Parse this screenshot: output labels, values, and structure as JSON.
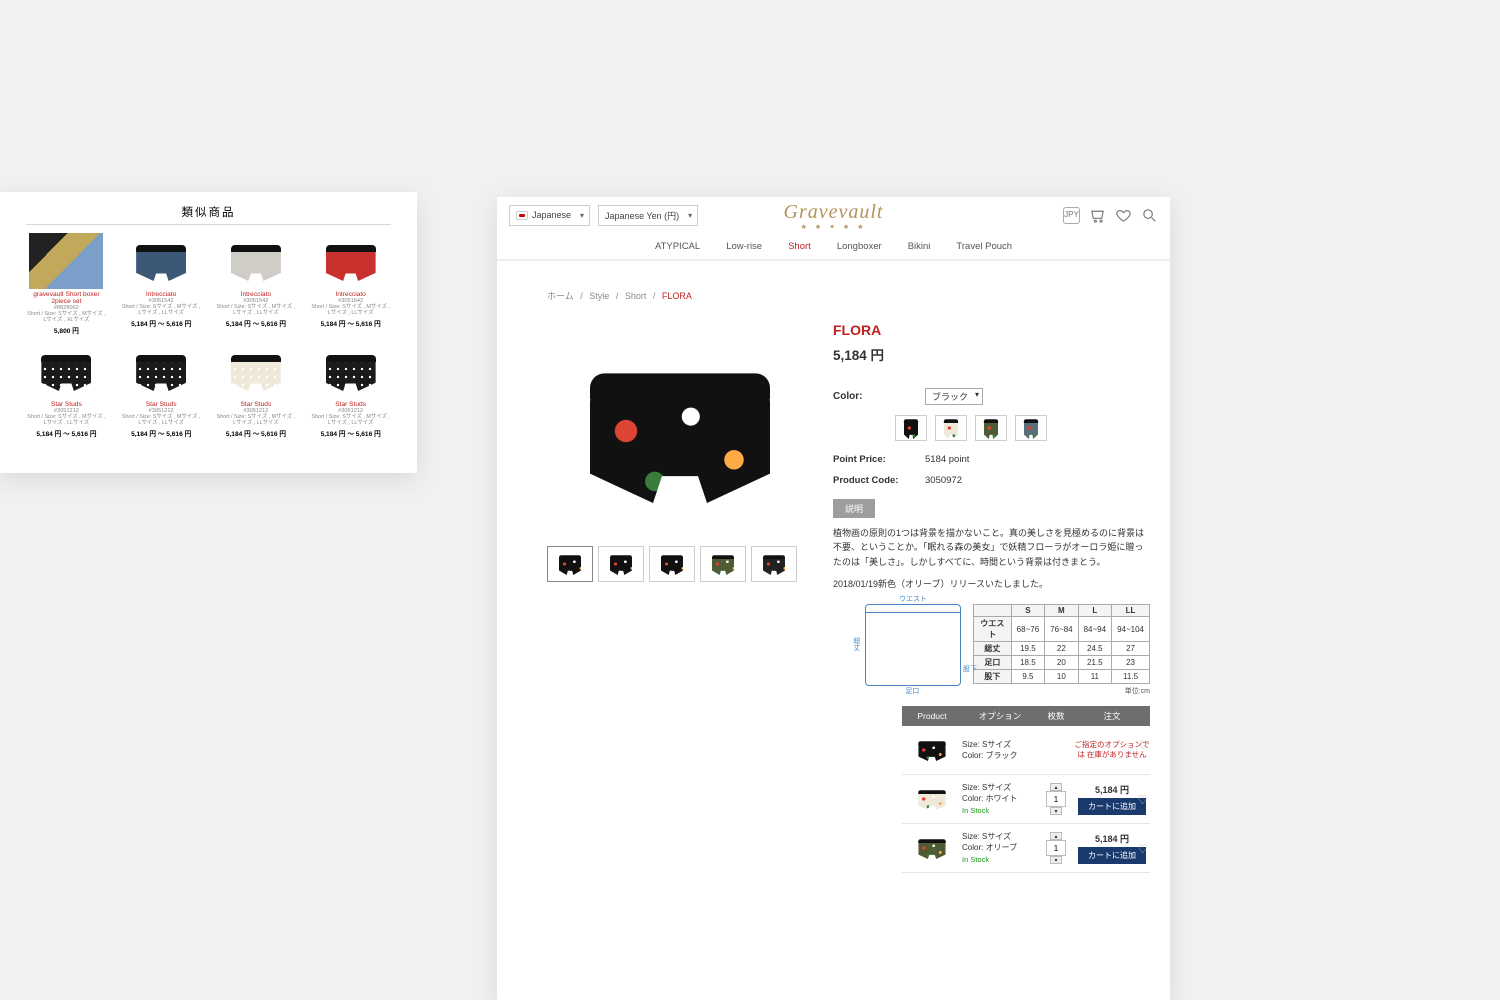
{
  "related": {
    "title": "類似商品",
    "cards": [
      {
        "name": "gravevault Short boxer 2piece set",
        "code": "#8828062",
        "sizes": "Short / Size: Sサイズ , Mサイズ , Lサイズ , XLサイズ",
        "price": "5,800 円",
        "color": "set"
      },
      {
        "name": "Intrecciato",
        "code": "#3051542",
        "sizes": "Short / Size: Sサイズ , Mサイズ , Lサイズ , LLサイズ",
        "price": "5,184 円 ～ 5,616 円",
        "color": "#3b5876"
      },
      {
        "name": "Intrecciato",
        "code": "#3051542",
        "sizes": "Short / Size: Sサイズ , Mサイズ , Lサイズ , LLサイズ",
        "price": "5,184 円 ～ 5,616 円",
        "color": "#d0cdc6"
      },
      {
        "name": "Intrecciato",
        "code": "#3051542",
        "sizes": "Short / Size: Sサイズ , Mサイズ , Lサイズ , LLサイズ",
        "price": "5,184 円 ～ 5,616 円",
        "color": "#c9312f"
      },
      {
        "name": "Star Studs",
        "code": "#3051212",
        "sizes": "Short / Size: Sサイズ , Mサイズ , Lサイズ , LLサイズ",
        "price": "5,184 円 ～ 5,616 円",
        "color": "#1b1b1b",
        "pattern": "dot"
      },
      {
        "name": "Star Studs",
        "code": "#3051212",
        "sizes": "Short / Size: Sサイズ , Mサイズ , Lサイズ , LLサイズ",
        "price": "5,184 円 ～ 5,616 円",
        "color": "#1b1b1b",
        "pattern": "dot"
      },
      {
        "name": "Star Studs",
        "code": "#3051212",
        "sizes": "Short / Size: Sサイズ , Mサイズ , Lサイズ , LLサイズ",
        "price": "5,184 円 ～ 5,616 円",
        "color": "#efe9d9",
        "pattern": "dot"
      },
      {
        "name": "Star Studs",
        "code": "#3051212",
        "sizes": "Short / Size: Sサイズ , Mサイズ , Lサイズ , LLサイズ",
        "price": "5,184 円 ～ 5,616 円",
        "color": "#1b1b1b",
        "pattern": "dot"
      }
    ]
  },
  "header": {
    "lang": "Japanese",
    "currency": "Japanese Yen (円)",
    "brand": "Gravevault",
    "brand_sub": "★ ★ ✦ ★ ★"
  },
  "nav": {
    "items": [
      "ATYPICAL",
      "Low-rise",
      "Short",
      "Longboxer",
      "Bikini",
      "Travel Pouch"
    ],
    "active": 2
  },
  "breadcrumb": {
    "items": [
      "ホーム",
      "Style",
      "Short"
    ],
    "current": "FLORA",
    "sep": "/"
  },
  "product": {
    "title": "FLORA",
    "price": "5,184 円",
    "color_label": "Color:",
    "color_value": "ブラック",
    "point_label": "Point Price:",
    "point_value": "5184 point",
    "code_label": "Product Code:",
    "code_value": "3050972",
    "desc_tab": "説明",
    "desc": "植物画の原則の1つは背景を描かないこと。真の美しさを見極めるのに背景は不要、ということか。「眠れる森の美女」で妖精フローラがオーロラ姫に贈ったのは「美しさ」。しかしすべてに、時間という背景は付きまとう。",
    "note": "2018/01/19新色（オリーブ）リリースいたしました。",
    "swatches": [
      {
        "c": "#111",
        "p": "flower"
      },
      {
        "c": "#efe9da",
        "p": "flower"
      },
      {
        "c": "#4e5c34",
        "p": "flower"
      },
      {
        "c": "#5b6e7b",
        "p": "flower"
      }
    ],
    "thumbs": [
      {
        "c": "#111"
      },
      {
        "c": "#111"
      },
      {
        "c": "#111"
      },
      {
        "c": "#4e5c34"
      },
      {
        "c": "#222"
      }
    ]
  },
  "sizes": {
    "diagram": {
      "top": "ウエスト",
      "side": "総丈",
      "leg": "股下",
      "bot": "足口"
    },
    "unit": "単位:cm",
    "headers": [
      "",
      "S",
      "M",
      "L",
      "LL"
    ],
    "rows": [
      [
        "ウエスト",
        "68~76",
        "76~84",
        "84~94",
        "94~104"
      ],
      [
        "総丈",
        "19.5",
        "22",
        "24.5",
        "27"
      ],
      [
        "足口",
        "18.5",
        "20",
        "21.5",
        "23"
      ],
      [
        "股下",
        "9.5",
        "10",
        "11",
        "11.5"
      ]
    ]
  },
  "variants": {
    "headers": {
      "product": "Product",
      "option": "オプション",
      "qty": "枚数",
      "order": "注文"
    },
    "rows": [
      {
        "size": "Size: Sサイズ",
        "color": "Color: ブラック",
        "stock": "",
        "swatch": "#111",
        "status": "oos",
        "oos": "ご指定のオプションでは\n在庫がありません"
      },
      {
        "size": "Size: Sサイズ",
        "color": "Color: ホワイト",
        "stock": "In Stock",
        "swatch": "#efe9da",
        "status": "ok",
        "qty": "1",
        "price": "5,184 円",
        "btn": "カートに追加"
      },
      {
        "size": "Size: Sサイズ",
        "color": "Color: オリーブ",
        "stock": "In Stock",
        "swatch": "#4e5c34",
        "status": "ok",
        "qty": "1",
        "price": "5,184 円",
        "btn": "カートに追加"
      }
    ]
  }
}
